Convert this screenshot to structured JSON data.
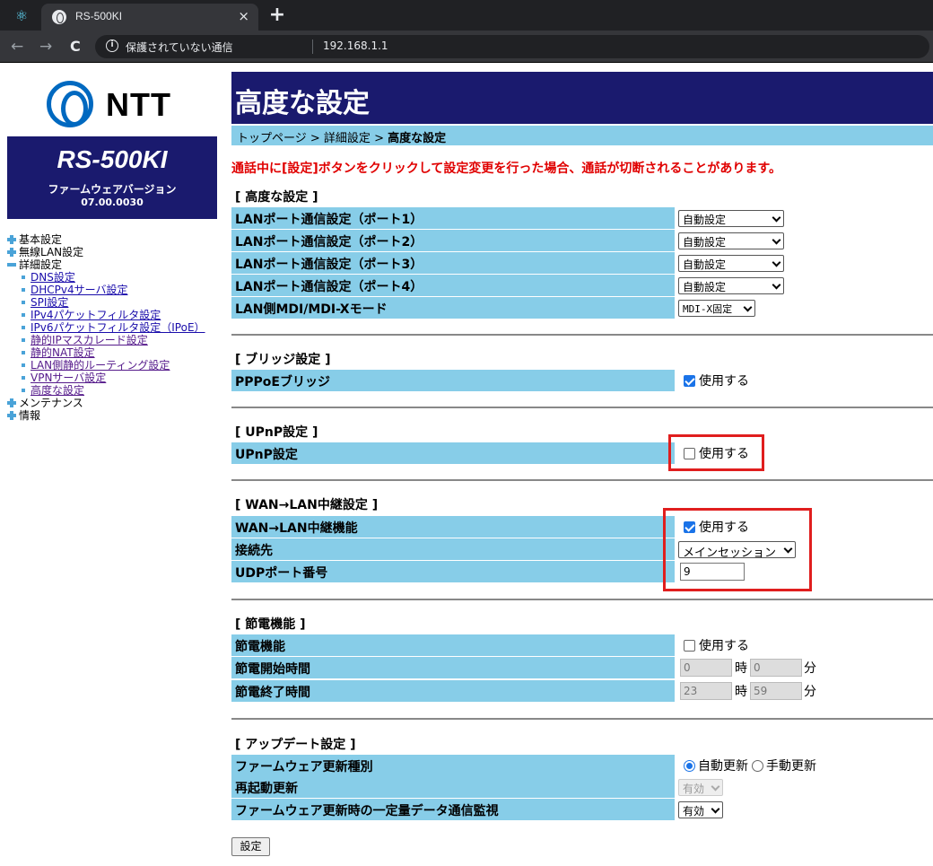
{
  "browser": {
    "tab_title": "RS-500KI",
    "tab_close": "×",
    "new_tab": "+",
    "security_text": "保護されていない通信",
    "url": "192.168.1.1",
    "back": "←",
    "forward": "→",
    "reload": "C"
  },
  "sidebar": {
    "brand": "NTT",
    "model": "RS-500KI",
    "firmware_label": "ファームウェアバージョン",
    "firmware_version": "07.00.0030",
    "menu": {
      "basic": "基本設定",
      "wireless": "無線LAN設定",
      "detail": "詳細設定",
      "detail_items": [
        "DNS設定",
        "DHCPv4サーバ設定",
        "SPI設定",
        "IPv4パケットフィルタ設定",
        "IPv6パケットフィルタ設定（IPoE）",
        "静的IPマスカレード設定",
        "静的NAT設定",
        "LAN側静的ルーティング設定",
        "VPNサーバ設定",
        "高度な設定"
      ],
      "maintenance": "メンテナンス",
      "info": "情報"
    }
  },
  "main": {
    "title": "高度な設定",
    "breadcrumb": {
      "p1": "トップページ",
      "sep": " > ",
      "p2": "詳細設定",
      "p3": "高度な設定"
    },
    "warning": "通話中に[設定]ボタンをクリックして設定変更を行った場合、通話が切断されることがあります。",
    "sections": {
      "advanced": {
        "heading": "[ 高度な設定 ]",
        "rows": [
          {
            "label": "LANポート通信設定（ポート1）",
            "value": "自動設定"
          },
          {
            "label": "LANポート通信設定（ポート2）",
            "value": "自動設定"
          },
          {
            "label": "LANポート通信設定（ポート3）",
            "value": "自動設定"
          },
          {
            "label": "LANポート通信設定（ポート4）",
            "value": "自動設定"
          },
          {
            "label": "LAN側MDI/MDI-Xモード",
            "value": "MDI-X固定"
          }
        ]
      },
      "bridge": {
        "heading": "[ ブリッジ設定 ]",
        "label": "PPPoEブリッジ",
        "checkbox": "使用する",
        "checked": true
      },
      "upnp": {
        "heading": "[ UPnP設定 ]",
        "label": "UPnP設定",
        "checkbox": "使用する",
        "checked": false
      },
      "wan": {
        "heading": "[ WAN→LAN中継設定 ]",
        "relay_label": "WAN→LAN中継機能",
        "relay_checkbox": "使用する",
        "relay_checked": true,
        "dest_label": "接続先",
        "dest_value": "メインセッション",
        "udp_label": "UDPポート番号",
        "udp_value": "9"
      },
      "power": {
        "heading": "[ 節電機能 ]",
        "func_label": "節電機能",
        "func_checkbox": "使用する",
        "func_checked": false,
        "start_label": "節電開始時間",
        "start_hour": "0",
        "start_min": "0",
        "end_label": "節電終了時間",
        "end_hour": "23",
        "end_min": "59",
        "hour_unit": "時",
        "min_unit": "分"
      },
      "update": {
        "heading": "[ アップデート設定 ]",
        "type_label": "ファームウェア更新種別",
        "opt_auto": "自動更新",
        "opt_manual": "手動更新",
        "selected": "自動更新",
        "reboot_label": "再起動更新",
        "reboot_value": "有効",
        "monitor_label": "ファームウェア更新時の一定量データ通信監視",
        "monitor_value": "有効"
      }
    },
    "submit": "設定"
  },
  "colors": {
    "header": "#1a1a6e",
    "row_label": "#87cde8",
    "warning": "#e00000",
    "highlight": "#e01e1e",
    "logo": "#0069c0"
  }
}
